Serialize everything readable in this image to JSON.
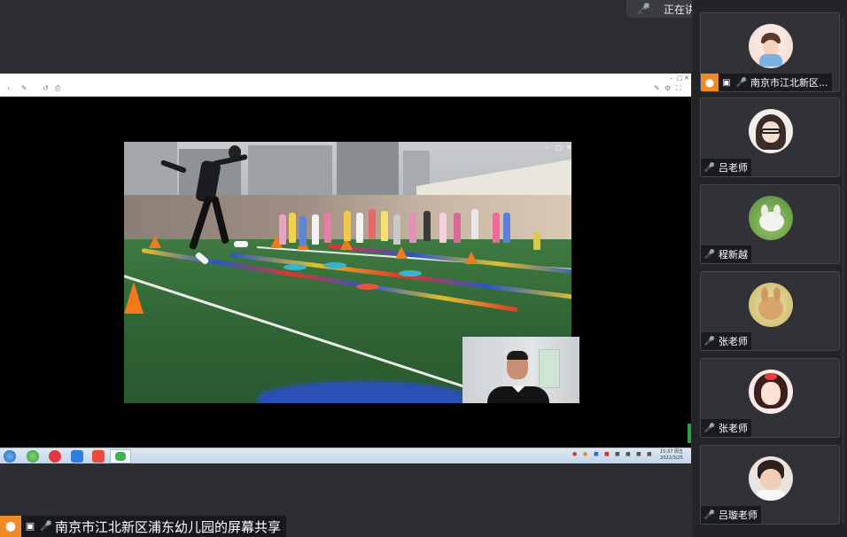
{
  "speaking": {
    "label": "正在讲话:",
    "mic_icon": "mic-muted-icon",
    "reply_icon": "return-icon"
  },
  "share": {
    "caption": "南京市江北新区浦东幼儿园的屏幕共享",
    "taskbar": {
      "clock_time": "15:37 周五",
      "clock_date": "2022/3/25"
    }
  },
  "participants": [
    {
      "name": "南京市江北新区...",
      "is_host": true,
      "sharing": true,
      "muted": true,
      "avatar": "cartoon-child-avatar"
    },
    {
      "name": "吕老师",
      "is_host": false,
      "sharing": false,
      "muted": true,
      "avatar": "cartoon-girl-avatar"
    },
    {
      "name": "程新越",
      "is_host": false,
      "sharing": false,
      "muted": true,
      "avatar": "rabbit-photo-avatar"
    },
    {
      "name": "张老师",
      "is_host": false,
      "sharing": false,
      "muted": true,
      "avatar": "bunny-photo-avatar"
    },
    {
      "name": "张老师",
      "is_host": false,
      "sharing": false,
      "muted": true,
      "avatar": "anime-girl-avatar"
    },
    {
      "name": "吕璇老师",
      "is_host": false,
      "sharing": false,
      "muted": true,
      "avatar": "baby-photo-avatar"
    }
  ],
  "colors": {
    "host_orange": "#f08a24",
    "muted_red": "#d64545",
    "panel_bg": "#303236",
    "app_bg": "#2b2d31"
  }
}
